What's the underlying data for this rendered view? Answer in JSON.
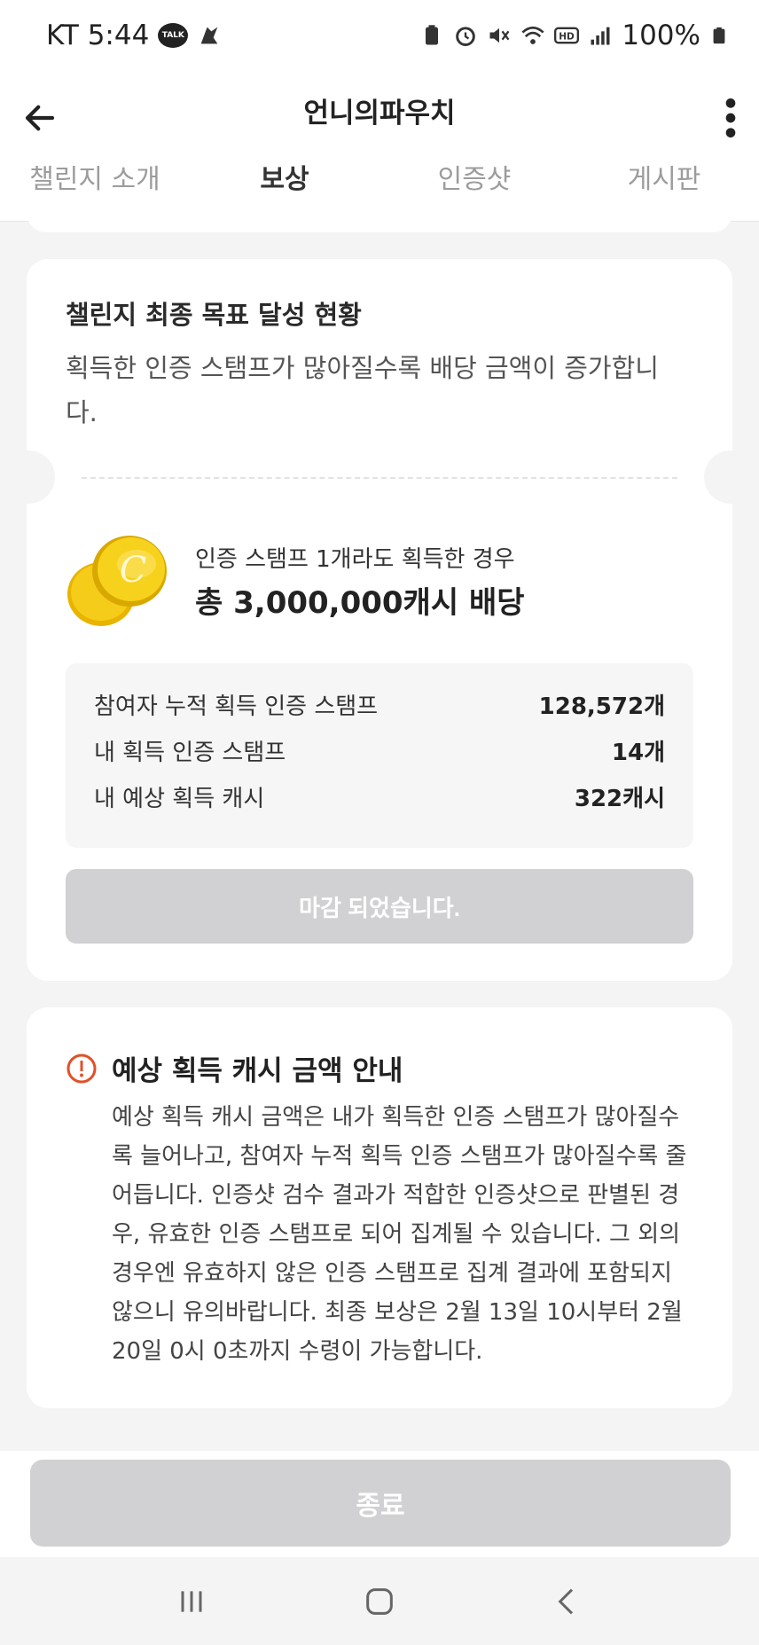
{
  "status_bar": {
    "carrier_time": "KT 5:44",
    "talk_badge": "TALK",
    "battery": "100%"
  },
  "header": {
    "title": "언니의파우치"
  },
  "tabs": [
    {
      "label": "챌린지 소개",
      "active": false
    },
    {
      "label": "보상",
      "active": true
    },
    {
      "label": "인증샷",
      "active": false
    },
    {
      "label": "게시판",
      "active": false
    }
  ],
  "goal_card": {
    "title": "챌린지 최종 목표 달성 현황",
    "description": "획득한 인증 스탬프가 많아질수록 배당 금액이 증가합니다.",
    "reward_condition": "인증 스탬프 1개라도 획득한 경우",
    "reward_amount": "총 3,000,000캐시 배당",
    "coin_letter": "C",
    "stats": [
      {
        "label": "참여자 누적 획득 인증 스탬프",
        "value": "128,572개"
      },
      {
        "label": "내 획득 인증 스탬프",
        "value": "14개"
      },
      {
        "label": "내 예상 획득 캐시",
        "value": "322캐시"
      }
    ],
    "closed_label": "마감 되었습니다."
  },
  "info_card": {
    "title": "예상 획득 캐시 금액 안내",
    "body": "예상 획득 캐시 금액은 내가 획득한 인증 스탬프가 많아질수록 늘어나고, 참여자 누적 획득 인증 스탬프가 많아질수록 줄어듭니다. 인증샷 검수 결과가 적합한 인증샷으로 판별된 경우, 유효한 인증 스탬프로 되어 집계될 수 있습니다. 그 외의 경우엔 유효하지 않은 인증 스탬프로 집계 결과에 포함되지 않으니 유의바랍니다. 최종 보상은 2월 13일 10시부터 2월 20일 0시 0초까지 수령이 가능합니다."
  },
  "footer": {
    "end_label": "종료"
  },
  "colors": {
    "accent_tab": "#4a3f3f",
    "warning": "#e0502a",
    "coin": "#f2c200",
    "disabled_button": "#d1d1d3"
  },
  "icons": {
    "back": "back-arrow-icon",
    "more": "more-vertical-icon",
    "warning": "warning-circle-icon",
    "coin": "coin-icon"
  }
}
